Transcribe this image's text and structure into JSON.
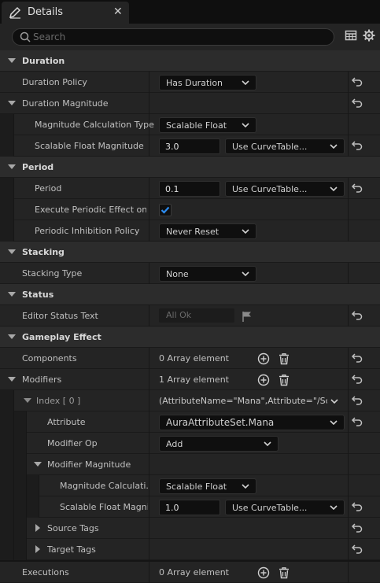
{
  "tab": {
    "title": "Details",
    "icon": "pencil-icon",
    "close": "✕"
  },
  "search": {
    "placeholder": "Search",
    "value": ""
  },
  "toolbar": {
    "grid_icon": "table-view-icon",
    "settings_icon": "gear-icon"
  },
  "colors": {
    "background": "#242424",
    "category": "#2c2c2c",
    "checkbox_accent": "#2d8cf0"
  },
  "sections": {
    "duration": {
      "title": "Duration",
      "policy_label": "Duration Policy",
      "policy_value": "Has Duration",
      "magnitude_label": "Duration Magnitude",
      "calc_type_label": "Magnitude Calculation Type",
      "calc_type_value": "Scalable Float",
      "sfm_label": "Scalable Float Magnitude",
      "sfm_value": "3.0",
      "sfm_curve": "Use CurveTable..."
    },
    "period": {
      "title": "Period",
      "period_label": "Period",
      "period_value": "0.1",
      "period_curve": "Use CurveTable...",
      "execute_label": "Execute Periodic Effect on...",
      "execute_checked": true,
      "inhibition_label": "Periodic Inhibition Policy",
      "inhibition_value": "Never Reset"
    },
    "stacking": {
      "title": "Stacking",
      "type_label": "Stacking Type",
      "type_value": "None"
    },
    "status": {
      "title": "Status",
      "editor_label": "Editor Status Text",
      "editor_value": "All Ok"
    },
    "gameplay": {
      "title": "Gameplay Effect",
      "components_label": "Components",
      "components_value": "0 Array element",
      "modifiers_label": "Modifiers",
      "modifiers_value": "1 Array element",
      "index_label": "Index [ 0 ]",
      "index_value": "(AttributeName=\"Mana\",Attribute=\"/Scr",
      "attribute_label": "Attribute",
      "attribute_value": "AuraAttributeSet.Mana",
      "modop_label": "Modifier Op",
      "modop_value": "Add",
      "modmag_label": "Modifier Magnitude",
      "mag_calc_label": "Magnitude Calculati...",
      "mag_calc_value": "Scalable Float",
      "mag_sfm_label": "Scalable Float Magni...",
      "mag_sfm_value": "1.0",
      "mag_sfm_curve": "Use CurveTable...",
      "source_tags_label": "Source Tags",
      "target_tags_label": "Target Tags",
      "executions_label": "Executions",
      "executions_value": "0 Array element"
    }
  }
}
